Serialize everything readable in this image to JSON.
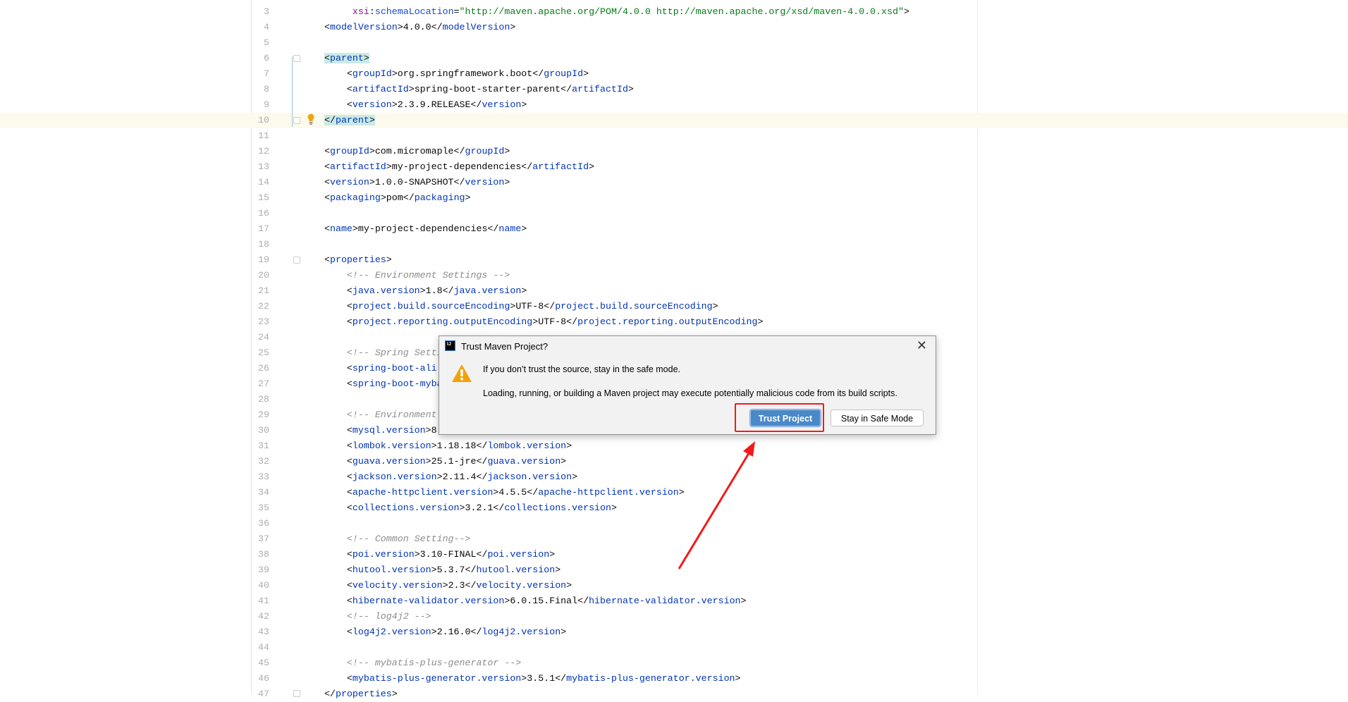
{
  "editor": {
    "lines": [
      {
        "n": 3,
        "text": "     xsi:schemaLocation=\"http://maven.apache.org/POM/4.0.0 http://maven.apache.org/xsd/maven-4.0.0.xsd\">"
      },
      {
        "n": 4,
        "text": "<modelVersion>4.0.0</modelVersion>"
      },
      {
        "n": 5,
        "text": ""
      },
      {
        "n": 6,
        "text": "<parent>"
      },
      {
        "n": 7,
        "text": "    <groupId>org.springframework.boot</groupId>"
      },
      {
        "n": 8,
        "text": "    <artifactId>spring-boot-starter-parent</artifactId>"
      },
      {
        "n": 9,
        "text": "    <version>2.3.9.RELEASE</version>"
      },
      {
        "n": 10,
        "text": "</parent>"
      },
      {
        "n": 11,
        "text": ""
      },
      {
        "n": 12,
        "text": "<groupId>com.micromaple</groupId>"
      },
      {
        "n": 13,
        "text": "<artifactId>my-project-dependencies</artifactId>"
      },
      {
        "n": 14,
        "text": "<version>1.0.0-SNAPSHOT</version>"
      },
      {
        "n": 15,
        "text": "<packaging>pom</packaging>"
      },
      {
        "n": 16,
        "text": ""
      },
      {
        "n": 17,
        "text": "<name>my-project-dependencies</name>"
      },
      {
        "n": 18,
        "text": ""
      },
      {
        "n": 19,
        "text": "<properties>"
      },
      {
        "n": 20,
        "text": "    <!-- Environment Settings -->"
      },
      {
        "n": 21,
        "text": "    <java.version>1.8</java.version>"
      },
      {
        "n": 22,
        "text": "    <project.build.sourceEncoding>UTF-8</project.build.sourceEncoding>"
      },
      {
        "n": 23,
        "text": "    <project.reporting.outputEncoding>UTF-8</project.reporting.outputEncoding>"
      },
      {
        "n": 24,
        "text": ""
      },
      {
        "n": 25,
        "text": "    <!-- Spring Setti"
      },
      {
        "n": 26,
        "text": "    <spring-boot-ali"
      },
      {
        "n": 27,
        "text": "    <spring-boot-myba"
      },
      {
        "n": 28,
        "text": ""
      },
      {
        "n": 29,
        "text": "    <!-- Environment"
      },
      {
        "n": 30,
        "text": "    <mysql.version>8"
      },
      {
        "n": 31,
        "text": "    <lombok.version>1.18.18</lombok.version>"
      },
      {
        "n": 32,
        "text": "    <guava.version>25.1-jre</guava.version>"
      },
      {
        "n": 33,
        "text": "    <jackson.version>2.11.4</jackson.version>"
      },
      {
        "n": 34,
        "text": "    <apache-httpclient.version>4.5.5</apache-httpclient.version>"
      },
      {
        "n": 35,
        "text": "    <collections.version>3.2.1</collections.version>"
      },
      {
        "n": 36,
        "text": ""
      },
      {
        "n": 37,
        "text": "    <!-- Common Setting-->"
      },
      {
        "n": 38,
        "text": "    <poi.version>3.10-FINAL</poi.version>"
      },
      {
        "n": 39,
        "text": "    <hutool.version>5.3.7</hutool.version>"
      },
      {
        "n": 40,
        "text": "    <velocity.version>2.3</velocity.version>"
      },
      {
        "n": 41,
        "text": "    <hibernate-validator.version>6.0.15.Final</hibernate-validator.version>"
      },
      {
        "n": 42,
        "text": "    <!-- log4j2 -->"
      },
      {
        "n": 43,
        "text": "    <log4j2.version>2.16.0</log4j2.version>"
      },
      {
        "n": 44,
        "text": ""
      },
      {
        "n": 45,
        "text": "    <!-- mybatis-plus-generator -->"
      },
      {
        "n": 46,
        "text": "    <mybatis-plus-generator.version>3.5.1</mybatis-plus-generator.version>"
      },
      {
        "n": 47,
        "text": "</properties>"
      }
    ],
    "current_line": 10,
    "highlighted_tag": "parent",
    "intention_icon": "lightbulb-icon"
  },
  "dialog": {
    "title": "Trust Maven Project?",
    "app_icon_label": "IJ",
    "message_primary": "If you don’t trust the source, stay in the safe mode.",
    "message_secondary": "Loading, running, or building a Maven project may execute potentially malicious code from its build scripts.",
    "trust_button": "Trust Project",
    "safe_mode_button": "Stay in Safe Mode",
    "close_icon": "close-icon",
    "warning_icon": "warning-icon"
  },
  "annotation": {
    "color": "#f21a1a",
    "shape": "red-box-with-arrow"
  },
  "colors": {
    "tag": "#0033b3",
    "comment": "#8c8c8c",
    "attribute_value": "#067d17",
    "primary_button": "#4a88c7",
    "warning": "#f0a30a"
  }
}
